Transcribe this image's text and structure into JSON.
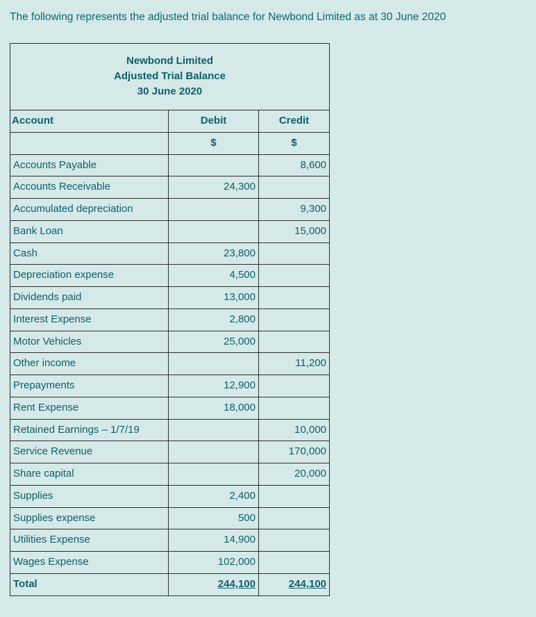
{
  "intro": "The following represents the adjusted trial balance for Newbond Limited as at 30 June 2020",
  "title": {
    "line1": "Newbond Limited",
    "line2": "Adjusted Trial Balance",
    "line3": "30 June 2020"
  },
  "headers": {
    "account": "Account",
    "debit": "Debit",
    "credit": "Credit",
    "symbol": "$"
  },
  "rows": [
    {
      "account": "Accounts Payable",
      "debit": "",
      "credit": "8,600"
    },
    {
      "account": "Accounts Receivable",
      "debit": "24,300",
      "credit": ""
    },
    {
      "account": "Accumulated depreciation",
      "debit": "",
      "credit": "9,300"
    },
    {
      "account": "Bank Loan",
      "debit": "",
      "credit": "15,000"
    },
    {
      "account": "Cash",
      "debit": "23,800",
      "credit": ""
    },
    {
      "account": "Depreciation expense",
      "debit": "4,500",
      "credit": ""
    },
    {
      "account": "Dividends paid",
      "debit": "13,000",
      "credit": ""
    },
    {
      "account": "Interest Expense",
      "debit": "2,800",
      "credit": ""
    },
    {
      "account": "Motor Vehicles",
      "debit": "25,000",
      "credit": ""
    },
    {
      "account": "Other income",
      "debit": "",
      "credit": "11,200"
    },
    {
      "account": "Prepayments",
      "debit": "12,900",
      "credit": ""
    },
    {
      "account": "Rent Expense",
      "debit": "18,000",
      "credit": ""
    },
    {
      "account": "Retained Earnings – 1/7/19",
      "debit": "",
      "credit": "10,000"
    },
    {
      "account": "Service Revenue",
      "debit": "",
      "credit": "170,000"
    },
    {
      "account": "Share capital",
      "debit": "",
      "credit": "20,000"
    },
    {
      "account": "Supplies",
      "debit": "2,400",
      "credit": ""
    },
    {
      "account": "Supplies expense",
      "debit": "500",
      "credit": ""
    },
    {
      "account": "Utilities Expense",
      "debit": "14,900",
      "credit": ""
    },
    {
      "account": "Wages Expense",
      "debit": "102,000",
      "credit": ""
    }
  ],
  "total": {
    "label": "Total",
    "debit": "244,100",
    "credit": "244,100"
  },
  "chart_data": {
    "type": "table",
    "title": "Newbond Limited Adjusted Trial Balance 30 June 2020",
    "columns": [
      "Account",
      "Debit $",
      "Credit $"
    ],
    "rows": [
      [
        "Accounts Payable",
        null,
        8600
      ],
      [
        "Accounts Receivable",
        24300,
        null
      ],
      [
        "Accumulated depreciation",
        null,
        9300
      ],
      [
        "Bank Loan",
        null,
        15000
      ],
      [
        "Cash",
        23800,
        null
      ],
      [
        "Depreciation expense",
        4500,
        null
      ],
      [
        "Dividends paid",
        13000,
        null
      ],
      [
        "Interest Expense",
        2800,
        null
      ],
      [
        "Motor Vehicles",
        25000,
        null
      ],
      [
        "Other income",
        null,
        11200
      ],
      [
        "Prepayments",
        12900,
        null
      ],
      [
        "Rent Expense",
        18000,
        null
      ],
      [
        "Retained Earnings – 1/7/19",
        null,
        10000
      ],
      [
        "Service Revenue",
        null,
        170000
      ],
      [
        "Share capital",
        null,
        20000
      ],
      [
        "Supplies",
        2400,
        null
      ],
      [
        "Supplies expense",
        500,
        null
      ],
      [
        "Utilities Expense",
        14900,
        null
      ],
      [
        "Wages Expense",
        102000,
        null
      ],
      [
        "Total",
        244100,
        244100
      ]
    ]
  }
}
